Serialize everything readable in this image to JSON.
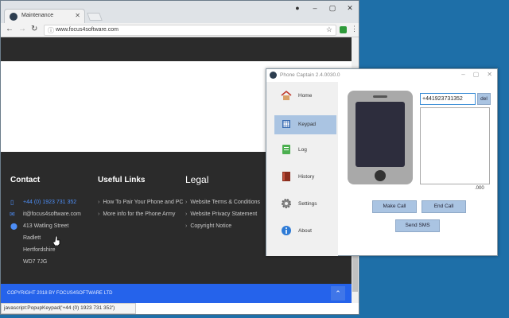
{
  "browser": {
    "tab_title": "Maintenance",
    "url": "www.focus4software.com",
    "status_text": "javascript:PopupKeypad('+44 (0) 1923 731 352')"
  },
  "footer": {
    "contact": {
      "title": "Contact",
      "phone": "+44 (0) 1923 731 352",
      "email": "it@focus4software.com",
      "address": [
        "413 Watling Street",
        "Radlett",
        "Hertfordshire",
        "WD7 7JG"
      ]
    },
    "useful_links": {
      "title": "Useful Links",
      "items": [
        "How To Pair Your Phone and PC",
        "More info for the Phone Army"
      ]
    },
    "legal": {
      "title": "Legal",
      "items": [
        "Website Terms & Conditions",
        "Website Privacy Statement",
        "Copyright Notice"
      ]
    },
    "copyright": "COPYRIGHT 2018 BY FOCUS4SOFTWARE LTD"
  },
  "phone_captain": {
    "title": "Phone Captain 2.4.0030.0",
    "nav": [
      {
        "label": "Home",
        "icon": "home-icon"
      },
      {
        "label": "Keypad",
        "icon": "keypad-icon",
        "active": true
      },
      {
        "label": "Log",
        "icon": "log-icon"
      },
      {
        "label": "History",
        "icon": "history-icon"
      },
      {
        "label": "Settings",
        "icon": "settings-icon"
      },
      {
        "label": "About",
        "icon": "about-icon"
      }
    ],
    "number": "+441923731352",
    "del_label": "del",
    "duration": ".000",
    "make_call": "Make Call",
    "end_call": "End Call",
    "send_sms": "Send SMS"
  },
  "colors": {
    "desktop": "#1e6fa8",
    "footer_bg": "#2b2b2b",
    "accent_blue": "#2563eb",
    "button_blue": "#aac4e2"
  }
}
